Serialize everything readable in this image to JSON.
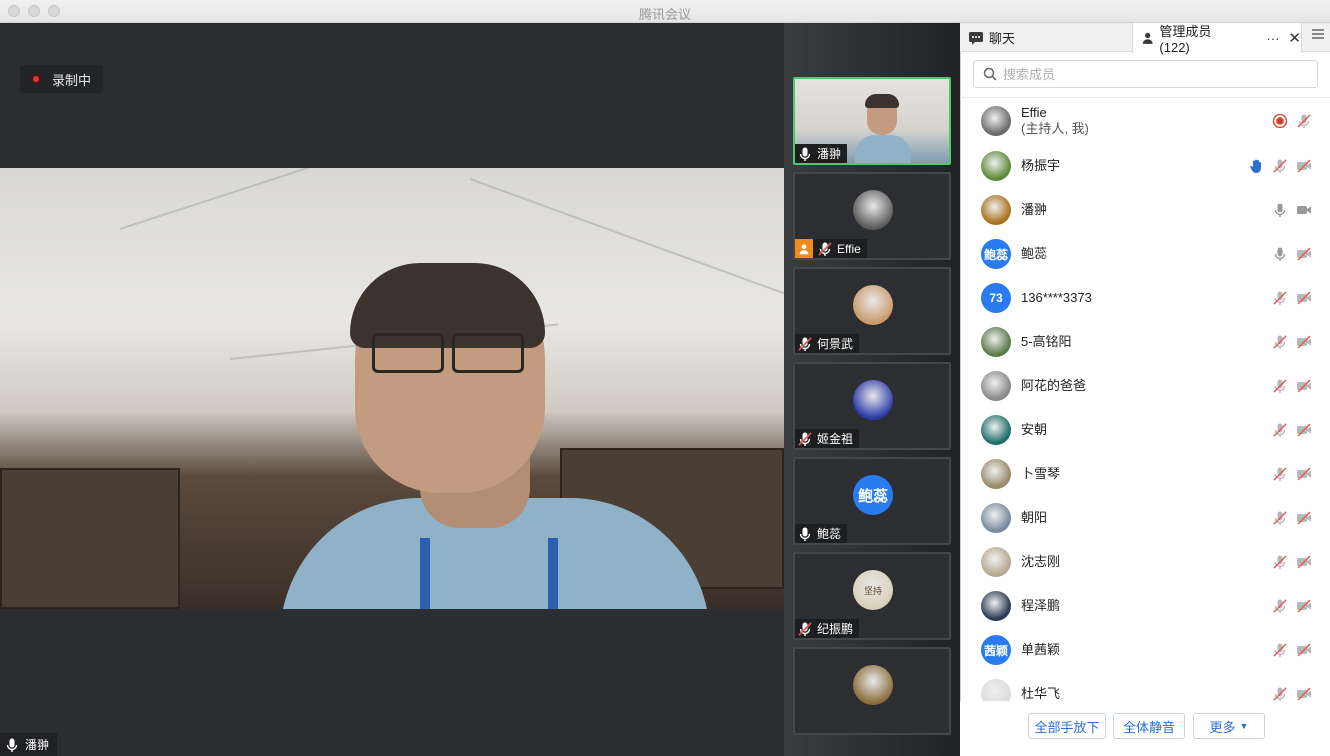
{
  "window": {
    "title": "腾讯会议"
  },
  "recording": {
    "label": "录制中"
  },
  "main_video": {
    "speaker_name": "潘翀"
  },
  "gallery": [
    {
      "name": "潘翀",
      "mic": "on",
      "active": true,
      "kind": "video"
    },
    {
      "name": "Effie",
      "mic": "muted",
      "host": true,
      "kind": "photo",
      "color": "#5b5b5b"
    },
    {
      "name": "何景武",
      "mic": "muted",
      "kind": "photo",
      "color": "#c99b6a"
    },
    {
      "name": "姬金祖",
      "mic": "muted",
      "kind": "photo",
      "color": "#2b3aa8"
    },
    {
      "name": "鲍蕊",
      "mic": "on",
      "kind": "text",
      "avatar_text": "鲍蕊"
    },
    {
      "name": "纪振鹏",
      "mic": "muted",
      "kind": "photo",
      "color": "#d8d0b8",
      "avatar_text": "坚持"
    },
    {
      "name": "",
      "mic": "",
      "kind": "photo",
      "color": "#8a6d3b"
    }
  ],
  "panel": {
    "tab_chat": "聊天",
    "tab_members": "管理成员 (122)",
    "more_label": "···",
    "search_placeholder": "搜索成员",
    "members": [
      {
        "name": "Effie",
        "subtitle": "(主持人, 我)",
        "avatar_color": "#6b6b6b",
        "recording": true,
        "mic": "muted",
        "video": "none"
      },
      {
        "name": "杨振宇",
        "avatar_color": "#5e8a3c",
        "hand": true,
        "mic": "muted",
        "video": "off"
      },
      {
        "name": "潘翀",
        "avatar_color": "#a8721c",
        "mic": "on",
        "video": "on"
      },
      {
        "name": "鲍蕊",
        "avatar_text": "鲍蕊",
        "avatar_color": "#2a7bf0",
        "mic": "on",
        "video": "off"
      },
      {
        "name": "136****3373",
        "avatar_text": "73",
        "avatar_color": "#2a7bf0",
        "mic": "muted",
        "video": "off"
      },
      {
        "name": "5-高铭阳",
        "avatar_color": "#5a7a4a",
        "mic": "muted",
        "video": "off"
      },
      {
        "name": "阿花的爸爸",
        "avatar_color": "#8a8a8a",
        "mic": "muted",
        "video": "off"
      },
      {
        "name": "安朝",
        "avatar_color": "#1f6e6a",
        "mic": "muted",
        "video": "off"
      },
      {
        "name": "卜雪琴",
        "avatar_color": "#9a8a6a",
        "mic": "muted",
        "video": "off"
      },
      {
        "name": "朝阳",
        "avatar_color": "#7a8aa0",
        "mic": "muted",
        "video": "off"
      },
      {
        "name": "沈志刚",
        "avatar_color": "#b8a890",
        "mic": "muted",
        "video": "off"
      },
      {
        "name": "程泽鹏",
        "avatar_color": "#2a3a52",
        "mic": "muted",
        "video": "off"
      },
      {
        "name": "单茜颖",
        "avatar_text": "茜颖",
        "avatar_color": "#2a7bf0",
        "mic": "muted",
        "video": "off"
      },
      {
        "name": "杜华飞",
        "avatar_color": "#dcdcdc",
        "mic": "muted",
        "video": "off"
      }
    ],
    "footer": {
      "lower_all_hands": "全部手放下",
      "mute_all": "全体静音",
      "more": "更多"
    }
  },
  "colors": {
    "active_border": "#4ec96b",
    "accent_blue": "#2a6fd1",
    "record_red": "#e0392b",
    "muted_red": "#e05a5a"
  }
}
